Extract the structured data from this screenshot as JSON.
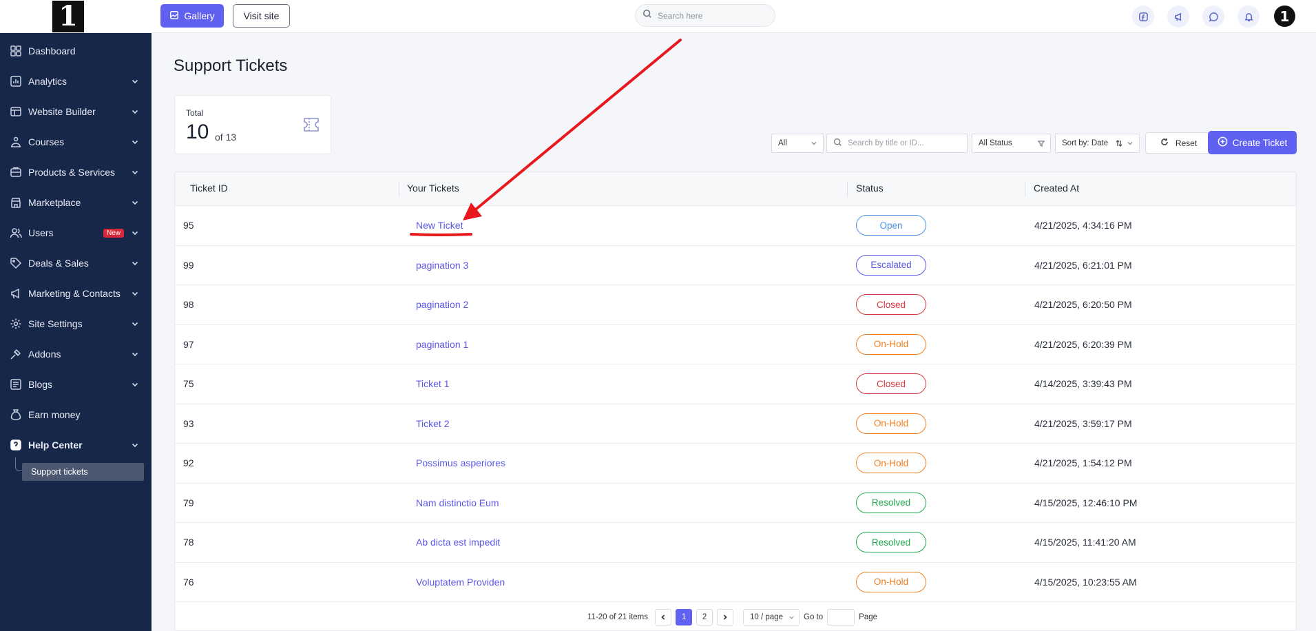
{
  "app": {
    "logo_text": "1"
  },
  "topbar": {
    "gallery_label": "Gallery",
    "visit_label": "Visit site",
    "search_placeholder": "Search here",
    "avatar_text": "1"
  },
  "sidebar": {
    "items": [
      {
        "label": "Dashboard",
        "icon": "dashboard-icon",
        "has_chevron": false
      },
      {
        "label": "Analytics",
        "icon": "analytics-icon",
        "has_chevron": true
      },
      {
        "label": "Website Builder",
        "icon": "website-builder-icon",
        "has_chevron": true
      },
      {
        "label": "Courses",
        "icon": "courses-icon",
        "has_chevron": true
      },
      {
        "label": "Products & Services",
        "icon": "products-icon",
        "has_chevron": true
      },
      {
        "label": "Marketplace",
        "icon": "marketplace-icon",
        "has_chevron": true
      },
      {
        "label": "Users",
        "icon": "users-icon",
        "has_chevron": true,
        "badge": "New"
      },
      {
        "label": "Deals & Sales",
        "icon": "tag-icon",
        "has_chevron": true
      },
      {
        "label": "Marketing & Contacts",
        "icon": "megaphone-icon",
        "has_chevron": true
      },
      {
        "label": "Site Settings",
        "icon": "gear-icon",
        "has_chevron": true
      },
      {
        "label": "Addons",
        "icon": "addons-icon",
        "has_chevron": true
      },
      {
        "label": "Blogs",
        "icon": "blogs-icon",
        "has_chevron": true
      },
      {
        "label": "Earn money",
        "icon": "money-bag-icon",
        "has_chevron": false
      },
      {
        "label": "Help Center",
        "icon": "help-icon",
        "has_chevron": true
      }
    ],
    "sub_item": "Support tickets"
  },
  "main": {
    "title": "Support Tickets",
    "total": {
      "label": "Total",
      "value": "10",
      "of": "of 13"
    },
    "filters": {
      "type": "All",
      "search_placeholder": "Search by title or ID...",
      "status": "All Status",
      "sort": "Sort by: Date",
      "reset_label": "Reset",
      "create_label": "Create Ticket"
    },
    "table": {
      "headers": [
        "Ticket ID",
        "Your Tickets",
        "Status",
        "Created At"
      ],
      "rows": [
        {
          "id": "95",
          "title": "New Ticket",
          "status": "Open",
          "created": "4/21/2025, 4:34:16 PM"
        },
        {
          "id": "99",
          "title": "pagination 3",
          "status": "Escalated",
          "created": "4/21/2025, 6:21:01 PM"
        },
        {
          "id": "98",
          "title": "pagination 2",
          "status": "Closed",
          "created": "4/21/2025, 6:20:50 PM"
        },
        {
          "id": "97",
          "title": "pagination 1",
          "status": "On-Hold",
          "created": "4/21/2025, 6:20:39 PM"
        },
        {
          "id": "75",
          "title": "Ticket 1",
          "status": "Closed",
          "created": "4/14/2025, 3:39:43 PM"
        },
        {
          "id": "93",
          "title": "Ticket 2",
          "status": "On-Hold",
          "created": "4/21/2025, 3:59:17 PM"
        },
        {
          "id": "92",
          "title": "Possimus asperiores",
          "status": "On-Hold",
          "created": "4/21/2025, 1:54:12 PM"
        },
        {
          "id": "79",
          "title": "Nam distinctio Eum",
          "status": "Resolved",
          "created": "4/15/2025, 12:46:10 PM"
        },
        {
          "id": "78",
          "title": "Ab dicta est impedit",
          "status": "Resolved",
          "created": "4/15/2025, 11:41:20 AM"
        },
        {
          "id": "76",
          "title": "Voluptatem Providen",
          "status": "On-Hold",
          "created": "4/15/2025, 10:23:55 AM"
        }
      ]
    },
    "pagination": {
      "range": "11-20 of 21 items",
      "pages": [
        "1",
        "2"
      ],
      "current": "1",
      "page_size": "10 / page",
      "goto_label": "Go to",
      "page_label": "Page"
    }
  },
  "status_colors": {
    "Open": "#4a90e2",
    "Escalated": "#5b57e8",
    "Closed": "#d9363e",
    "On-Hold": "#f07f1f",
    "Resolved": "#22a94f"
  },
  "accent_color": "#6161f1",
  "annotation_color": "#e8191e"
}
